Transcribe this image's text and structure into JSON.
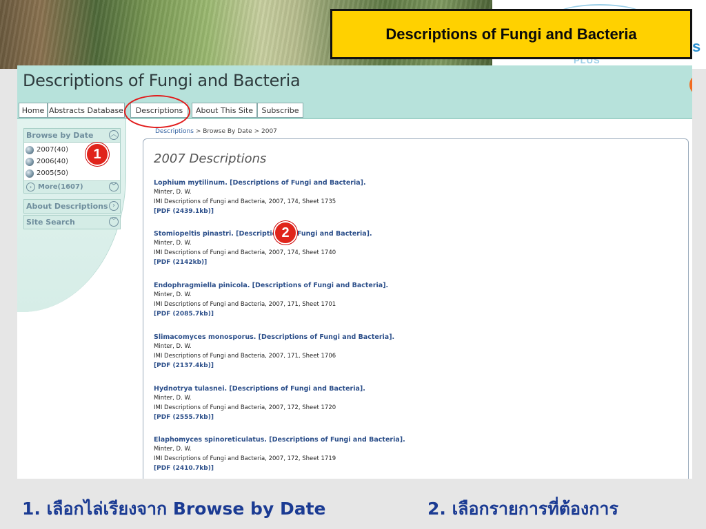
{
  "slide": {
    "title": "Descriptions of Fungi and Bacteria",
    "logo_partial": "s",
    "logo_plus": "PLUS",
    "captions": [
      "1. เลือกไล่เรียงจาก Browse by Date",
      "2. เลือกรายการที่ต้องการ"
    ],
    "markers": [
      "1",
      "2"
    ]
  },
  "site": {
    "title": "Descriptions of Fungi and Bacteria",
    "nav": [
      "Home",
      "Abstracts Database",
      "Descriptions",
      "About This Site",
      "Subscribe"
    ],
    "sidebar": {
      "browse_by_date": "Browse by Date",
      "years": [
        "2007(40)",
        "2006(40)",
        "2005(50)"
      ],
      "more": "More(1607)",
      "about": "About Descriptions",
      "site_search": "Site Search"
    },
    "breadcrumb": {
      "link": "Descriptions",
      "sep1": " > ",
      "mid": "Browse By Date",
      "sep2": " > ",
      "last": "2007"
    },
    "content_title": "2007 Descriptions",
    "entries": [
      {
        "title": "Lophium mytilinum. [Descriptions of Fungi and Bacteria].",
        "author": "Minter, D. W.",
        "source": "IMI Descriptions of Fungi and Bacteria, 2007, 174, Sheet 1735",
        "pdf": "[PDF (2439.1kb)]"
      },
      {
        "title": "Stomiopeltis pinastri. [Descriptions of Fungi and Bacteria].",
        "author": "Minter, D. W.",
        "source": "IMI Descriptions of Fungi and Bacteria, 2007, 174, Sheet 1740",
        "pdf": "[PDF (2142kb)]"
      },
      {
        "title": "Endophragmiella pinicola. [Descriptions of Fungi and Bacteria].",
        "author": "Minter, D. W.",
        "source": "IMI Descriptions of Fungi and Bacteria, 2007, 171, Sheet 1701",
        "pdf": "[PDF (2085.7kb)]"
      },
      {
        "title": "Slimacomyces monosporus. [Descriptions of Fungi and Bacteria].",
        "author": "Minter, D. W.",
        "source": "IMI Descriptions of Fungi and Bacteria, 2007, 171, Sheet 1706",
        "pdf": "[PDF (2137.4kb)]"
      },
      {
        "title": "Hydnotrya tulasnei. [Descriptions of Fungi and Bacteria].",
        "author": "Minter, D. W.",
        "source": "IMI Descriptions of Fungi and Bacteria, 2007, 172, Sheet 1720",
        "pdf": "[PDF (2555.7kb)]"
      },
      {
        "title": "Elaphomyces spinoreticulatus. [Descriptions of Fungi and Bacteria].",
        "author": "Minter, D. W.",
        "source": "IMI Descriptions of Fungi and Bacteria, 2007, 172, Sheet 1719",
        "pdf": "[PDF (2410.7kb)]"
      }
    ]
  }
}
